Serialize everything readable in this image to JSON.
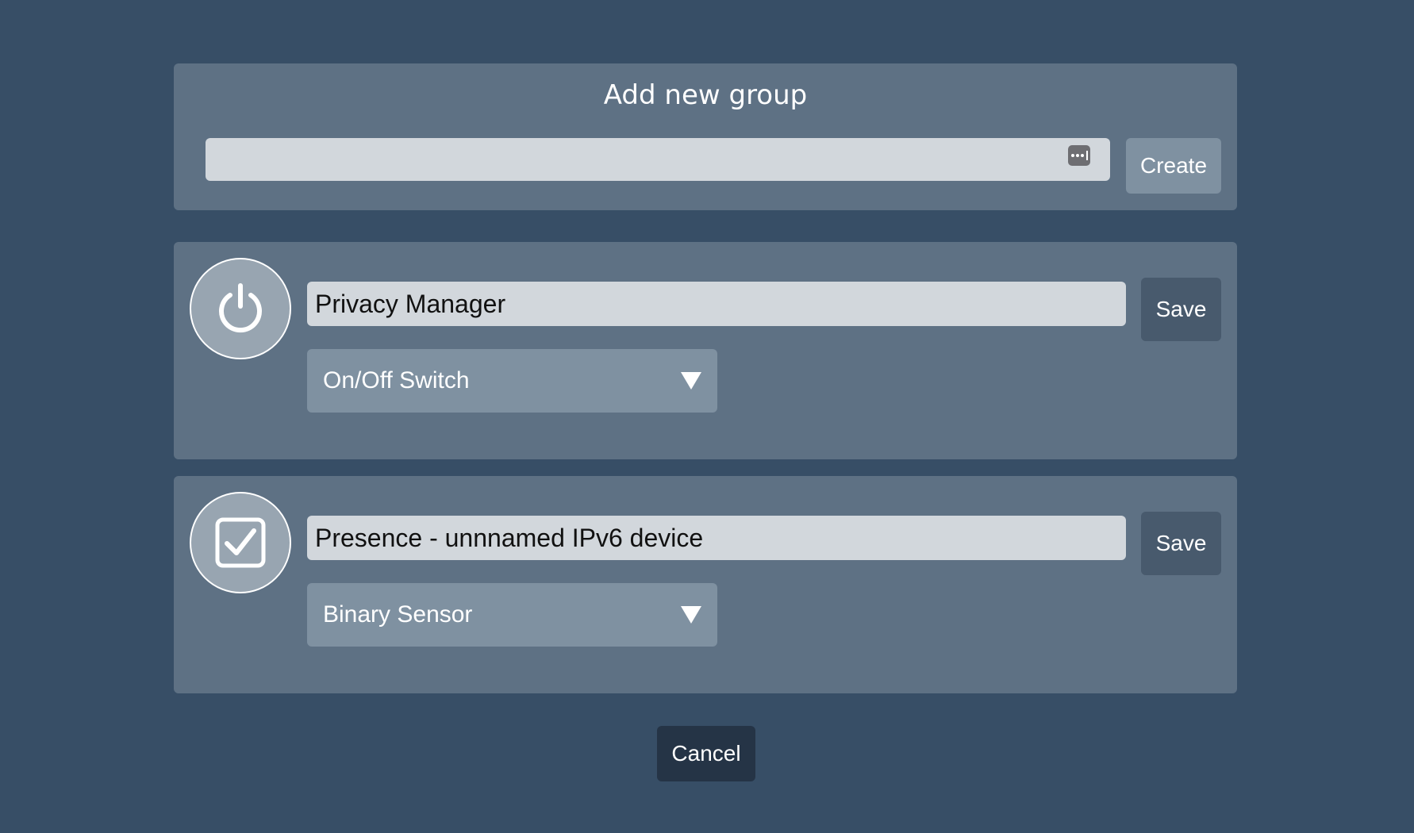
{
  "dialog": {
    "title": "Add new group",
    "new_group_input": {
      "value": "",
      "placeholder": ""
    },
    "create_label": "Create"
  },
  "groups": [
    {
      "icon": "power-icon",
      "name": "Privacy Manager",
      "type": "On/Off Switch",
      "save_label": "Save"
    },
    {
      "icon": "checkbox-icon",
      "name": "Presence - unnnamed IPv6 device",
      "type": "Binary Sensor",
      "save_label": "Save"
    }
  ],
  "cancel_label": "Cancel",
  "colors": {
    "background": "#374e66",
    "panel": "#5e7184",
    "input": "#d2d7dc",
    "button_light": "#7f91a1",
    "button_dark": "#485a6d",
    "cancel": "#253446"
  }
}
